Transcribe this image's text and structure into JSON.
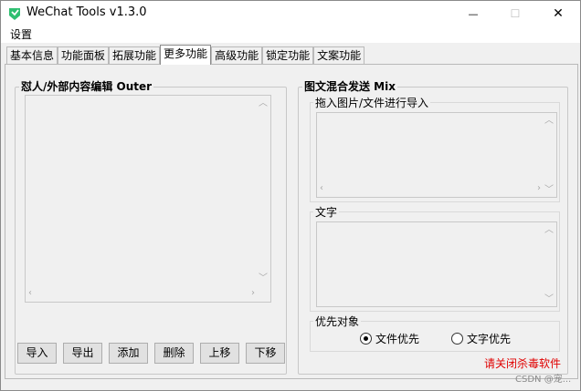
{
  "window": {
    "title": "WeChat Tools v1.3.0",
    "minimize": "—",
    "maximize": "☐",
    "close": "✕"
  },
  "menu": {
    "settings": "设置"
  },
  "tabs": [
    {
      "label": "基本信息"
    },
    {
      "label": "功能面板"
    },
    {
      "label": "拓展功能"
    },
    {
      "label": "更多功能",
      "active": true
    },
    {
      "label": "高级功能"
    },
    {
      "label": "锁定功能"
    },
    {
      "label": "文案功能"
    }
  ],
  "outer": {
    "title": "怼人/外部内容编辑 Outer",
    "buttons": {
      "import": "导入",
      "export": "导出",
      "add": "添加",
      "delete": "删除",
      "move_up": "上移",
      "move_down": "下移"
    }
  },
  "mix": {
    "title": "图文混合发送 Mix",
    "drag_drop_label": "拖入图片/文件进行导入",
    "text_label": "文字",
    "priority_label": "优先对象",
    "options": [
      {
        "label": "文件优先",
        "selected": true
      },
      {
        "label": "文字优先",
        "selected": false
      }
    ]
  },
  "warning": "请关闭杀毒软件",
  "watermark": "CSDN @宠..."
}
